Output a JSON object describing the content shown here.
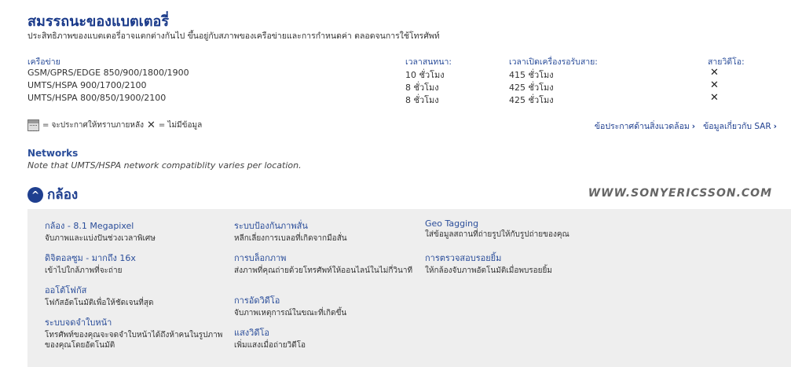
{
  "header": {
    "title": "สมรรถนะของแบตเตอรี่",
    "subtitle": "ประสิทธิภาพของแบตเตอรี่อาจแตกต่างกันไป ขึ้นอยู่กับสภาพของเครือข่ายและการกำหนดค่า ตลอดจนการใช้โทรศัพท์"
  },
  "battery_table": {
    "headers": [
      "เครือข่าย",
      "เวลาสนทนา:",
      "เวลาเปิดเครื่องรอรับสาย:",
      "สายวิดีโอ:"
    ],
    "rows": [
      {
        "network": "GSM/GPRS/EDGE 850/900/1800/1900",
        "talk": "10 ชั่วโมง",
        "standby": "415 ชั่วโมง",
        "video": "✕"
      },
      {
        "network": "UMTS/HSPA 900/1700/2100",
        "talk": "8 ชั่วโมง",
        "standby": "425 ชั่วโมง",
        "video": "✕"
      },
      {
        "network": "UMTS/HSPA 800/850/1900/2100",
        "talk": "8 ชั่วโมง",
        "standby": "425 ชั่วโมง",
        "video": "✕"
      }
    ]
  },
  "legend": {
    "calendar_text": "= จะประกาศให้ทราบภายหลัง",
    "cross_symbol": "✕",
    "cross_text": "= ไม่มีข้อมูล"
  },
  "links": {
    "environment": "ข้อประกาศด้านสิ่งแวดล้อม",
    "sar": "ข้อมูลเกี่ยวกับ SAR",
    "arrow": "›"
  },
  "networks": {
    "title": "Networks",
    "note": "Note that UMTS/HSPA network compatiblity varies per location."
  },
  "camera": {
    "toggle_icon": "^",
    "title": "กล้อง",
    "watermark": "WWW.SONYERICSSON.COM",
    "features": [
      {
        "title": "กล้อง - 8.1 Megapixel",
        "desc": "จับภาพและแบ่งปันช่วงเวลาพิเศษ"
      },
      {
        "title": "ระบบป้องกันภาพสั่น",
        "desc": "หลีกเลี่ยงการเบลอที่เกิดจากมือสั่น"
      },
      {
        "title": "Geo Tagging",
        "desc": "ใส่ข้อมูลสถานที่ถ่ายรูปให้กับรูปถ่ายของคุณ"
      },
      {
        "title": "ดิจิตอลซูม - มากถึง 16x",
        "desc": "เข้าไปใกล้ภาพที่จะถ่าย"
      },
      {
        "title": "การบล็อกภาพ",
        "desc": "ส่งภาพที่คุณถ่ายด้วยโทรศัพท์ให้ออนไลน์ในไม่กี่วินาที"
      },
      {
        "title": "การตรวจสอบรอยยิ้ม",
        "desc": "ให้กล้องจับภาพอัตโนมัติเมื่อพบรอยยิ้ม"
      },
      {
        "title": "ออโต้โฟกัส",
        "desc": "โฟกัสอัตโนมัติเพื่อให้ชัดเจนที่สุด"
      },
      {
        "title": "การอัดวิดีโอ",
        "desc": "จับภาพเหตุการณ์ในขณะที่เกิดขึ้น"
      },
      {
        "title": "ระบบจดจำใบหน้า",
        "desc": "โทรศัพท์ของคุณจะจดจำใบหน้าได้ถึงห้าคนในรูปภาพของคุณโดยอัตโนมัติ"
      },
      {
        "title": "แสงวิดีโอ",
        "desc": "เพิ่มแสงเมื่อถ่ายวิดีโอ"
      }
    ]
  }
}
